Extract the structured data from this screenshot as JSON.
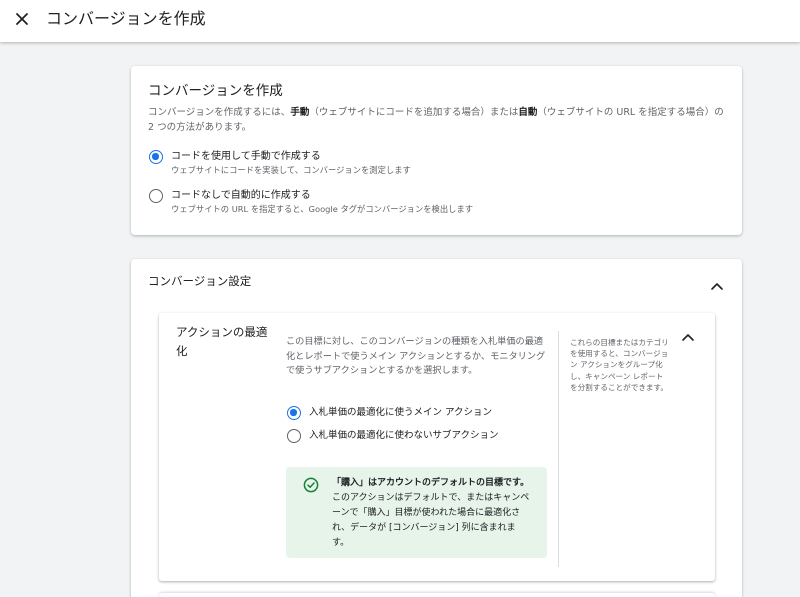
{
  "header": {
    "title": "コンバージョンを作成"
  },
  "create_card": {
    "title": "コンバージョンを作成",
    "desc_prefix": "コンバージョンを作成するには、",
    "desc_manual": "手動",
    "desc_middle": "（ウェブサイトにコードを追加する場合）または",
    "desc_auto": "自動",
    "desc_suffix": "（ウェブサイトの URL を指定する場合）の 2 つの方法があります。",
    "options": [
      {
        "label": "コードを使用して手動で作成する",
        "sub": "ウェブサイトにコードを実装して、コンバージョンを測定します",
        "selected": true
      },
      {
        "label": "コードなしで自動的に作成する",
        "sub": "ウェブサイトの URL を指定すると、Google タグがコンバージョンを検出します",
        "selected": false
      }
    ]
  },
  "settings_card": {
    "title": "コンバージョン設定",
    "action_opt": {
      "title": "アクションの最適化",
      "description": "この目標に対し、このコンバージョンの種類を入札単価の最適化とレポートで使うメイン アクションとするか、モニタリングで使うサブアクションとするかを選択します。",
      "options": [
        {
          "label": "入札単価の最適化に使うメイン アクション",
          "selected": true
        },
        {
          "label": "入札単価の最適化に使わないサブアクション",
          "selected": false
        }
      ],
      "notice_bold": "「購入」はアカウントのデフォルトの目標です。",
      "notice_rest": "このアクションはデフォルトで、またはキャンペーンで「購入」目標が使われた場合に最適化され、データが [コンバージョン] 列に含まれます。",
      "side_text": "これらの目標またはカテゴリを使用すると、コンバージョン アクションをグループ化し、キャンペーン レポートを分割することができます。"
    }
  },
  "colors": {
    "accent": "#1a73e8",
    "success": "#188038",
    "notice_bg": "#e6f4ea",
    "page_bg": "#f1f3f4"
  },
  "icons": [
    "close-icon",
    "chevron-up-icon",
    "check-circle-icon"
  ]
}
